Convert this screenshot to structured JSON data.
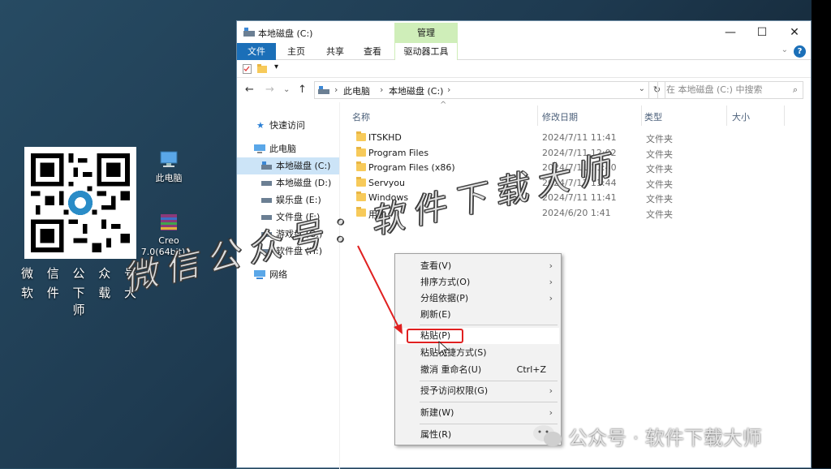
{
  "desktop": {
    "qr_caption_1": "微 信 公 众 号",
    "qr_caption_2": "软 件 下 载 大 师",
    "icons": [
      {
        "name": "computer-icon",
        "label": "此电脑"
      },
      {
        "name": "winrar-icon",
        "label": "Creo\n7.0(64bit)...."
      }
    ]
  },
  "window": {
    "title": "本地磁盘 (C:)",
    "manage_tab": "管理",
    "ribbon_tabs": [
      "文件",
      "主页",
      "共享",
      "查看",
      "驱动器工具"
    ],
    "controls": {
      "minimize": "—",
      "maximize": "☐",
      "close": "✕"
    },
    "help": "?"
  },
  "address": {
    "crumbs": [
      "此电脑",
      "本地磁盘 (C:)"
    ],
    "search_placeholder": "在 本地磁盘 (C:) 中搜索"
  },
  "nav": {
    "quick_access": "快速访问",
    "this_pc": "此电脑",
    "drives": [
      "本地磁盘 (C:)",
      "本地磁盘 (D:)",
      "娱乐盘 (E:)",
      "文件盘 (F:)",
      "游戏盘 (G:)",
      "软件盘 (H:)"
    ],
    "network": "网络"
  },
  "columns": [
    "名称",
    "修改日期",
    "类型",
    "大小"
  ],
  "files": [
    {
      "name": "ITSKHD",
      "date": "2024/7/11 11:41",
      "type": "文件夹"
    },
    {
      "name": "Program Files",
      "date": "2024/7/11 12:02",
      "type": "文件夹"
    },
    {
      "name": "Program Files (x86)",
      "date": "2024/7/11 11:40",
      "type": "文件夹"
    },
    {
      "name": "Servyou",
      "date": "2024/7/11 11:44",
      "type": "文件夹"
    },
    {
      "name": "Windows",
      "date": "2024/7/11 11:41",
      "type": "文件夹"
    },
    {
      "name": "用户",
      "date": "2024/6/20 1:41",
      "type": "文件夹"
    }
  ],
  "context_menu": {
    "view": "查看(V)",
    "sort": "排序方式(O)",
    "group": "分组依据(P)",
    "refresh": "刷新(E)",
    "paste": "粘贴(P)",
    "paste_shortcut": "粘贴快捷方式(S)",
    "undo": "撤消 重命名(U)",
    "undo_shortcut": "Ctrl+Z",
    "access": "授予访问权限(G)",
    "new": "新建(W)",
    "properties": "属性(R)"
  },
  "watermarks": {
    "main": "微信公众号：软件下载大师",
    "bottom": "公众号 · 软件下载大师"
  },
  "colors": {
    "accent": "#1b6fb8",
    "manage": "#cfeeb9",
    "highlight": "#e02020"
  }
}
